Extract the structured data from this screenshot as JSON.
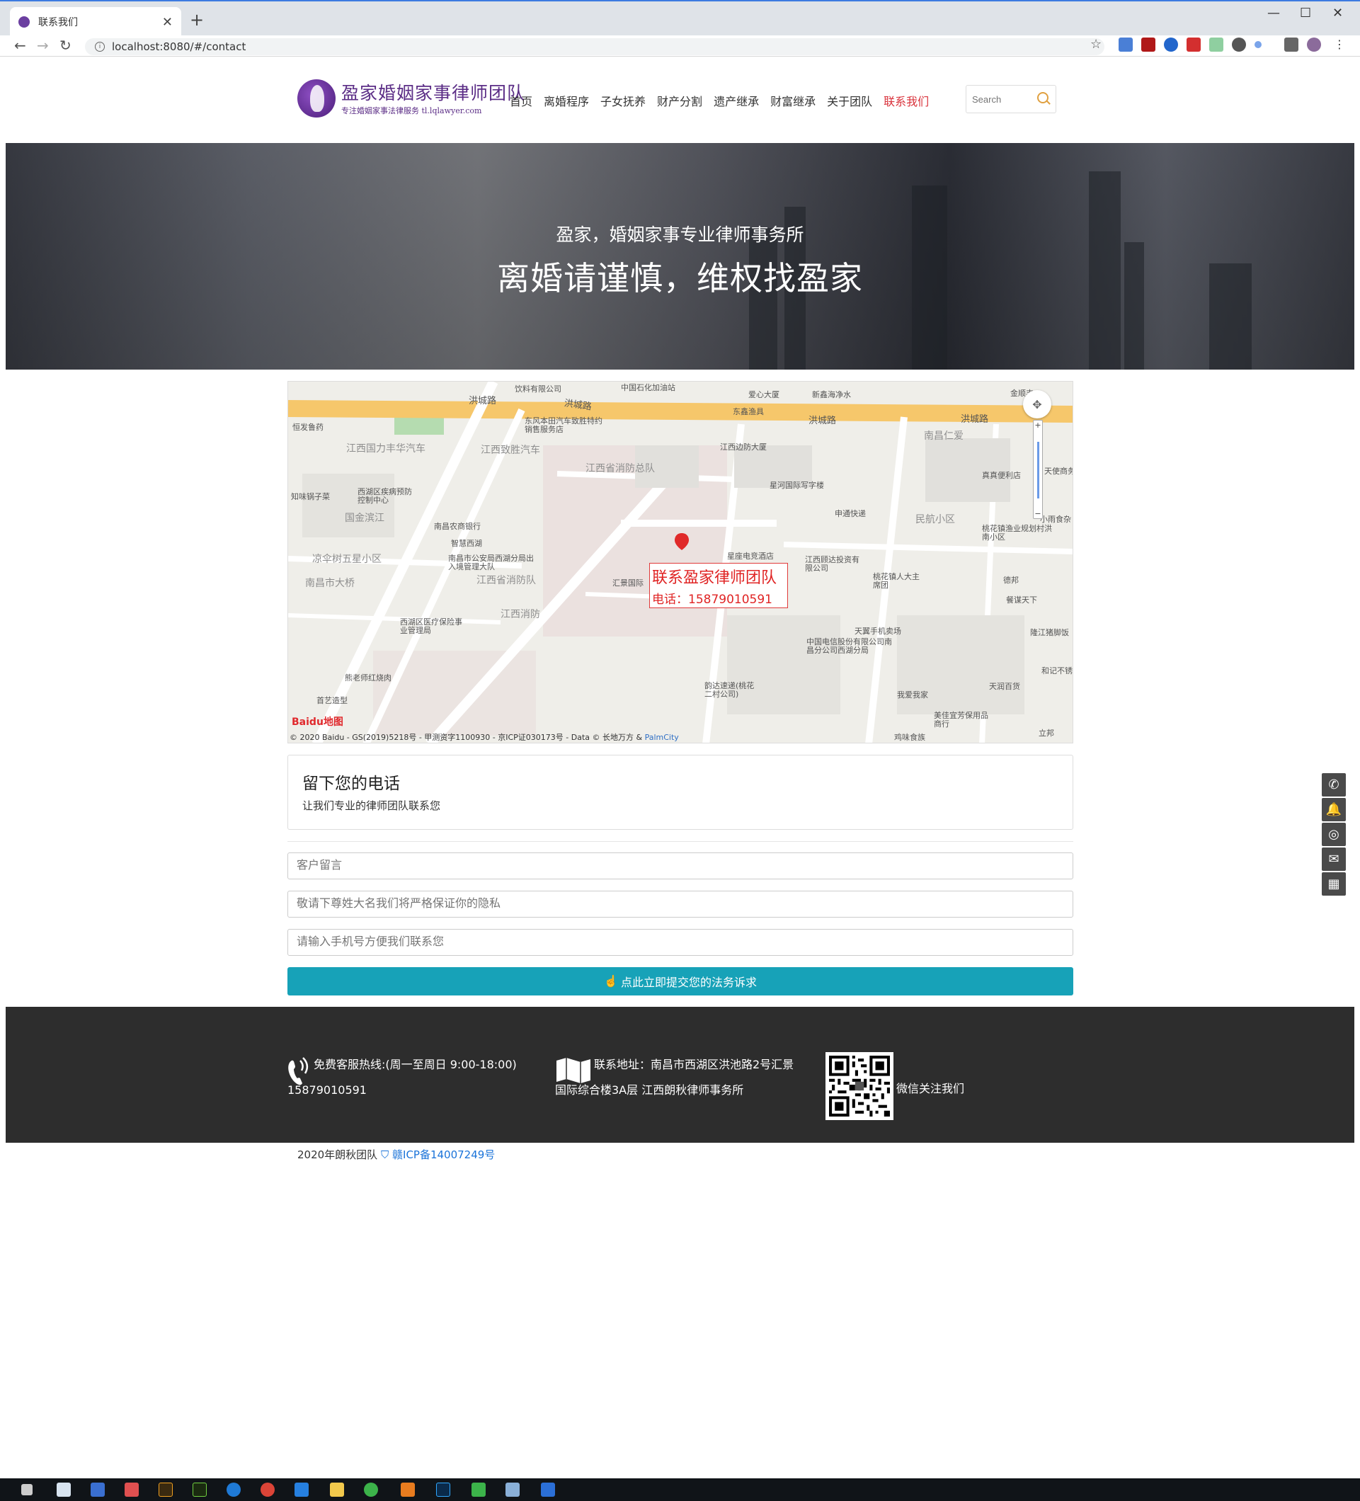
{
  "browser": {
    "tab_title": "联系我们",
    "tab_close": "✕",
    "new_tab": "+",
    "url": "localhost:8080/#/contact",
    "win_min": "—",
    "win_max": "☐",
    "win_close": "✕"
  },
  "header": {
    "logo_name": "盈家婚姻家事律师团队",
    "logo_sub": "专注婚姻家事法律服务 tl.lqlawyer.com",
    "nav": [
      "首页",
      "离婚程序",
      "子女抚养",
      "财产分割",
      "遗产继承",
      "财富继承",
      "关于团队",
      "联系我们"
    ],
    "active_nav": "联系我们",
    "search_placeholder": "Search"
  },
  "hero": {
    "subtitle": "盈家，婚姻家事专业律师事务所",
    "title": "离婚请谨慎，维权找盈家"
  },
  "map": {
    "label_title": "联系盈家律师团队",
    "label_phone": "电话：15879010591",
    "roads": [
      "洪城路",
      "洪城路",
      "洪城路",
      "洪城路"
    ],
    "pois_large": [
      "江西国力丰华汽车",
      "江西致胜汽车",
      "江西省消防总队",
      "国金滨江",
      "凉伞树五星小区",
      "南昌市大桥",
      "江西省消防队",
      "江西消防",
      "南昌仁爱",
      "民航小区"
    ],
    "pois": [
      "饮料有限公司",
      "中国石化加油站",
      "爱心大厦",
      "新鑫海净水",
      "金顺丰",
      "恒发鲁药",
      "东风本田汽车致胜特约销售服务店",
      "东鑫渔具",
      "江西边防大厦",
      "星河国际写字楼",
      "真真便利店",
      "天使商务",
      "知味锅子菜",
      "西湖区疾病预防控制中心",
      "南昌农商银行",
      "申通快递",
      "智慧西湖",
      "南昌市公安局西湖分局出入境管理大队",
      "星座电竞酒店",
      "江西顾达投资有限公司",
      "桃花镇渔业规划村洪南小区",
      "桃花镇人大主席团",
      "德邦",
      "餐谋天下",
      "西湖区医疗保险事业管理局",
      "天翼手机卖场",
      "中国电信股份有限公司南昌分公司西湖分局",
      "隆江猪脚饭",
      "熊老师红烧肉",
      "首艺造型",
      "韵达速递(桃花二村公司)",
      "我爱我家",
      "天润百货",
      "和记不锈",
      "美佳宜芳保用品商行",
      "立邦",
      "鸡味食族",
      "汇景国际",
      "小雨食杂"
    ],
    "copyright": "© 2020 Baidu - GS(2019)5218号 - 甲测资字1100930 - 京ICP证030173号 - Data © 长地万方 & ",
    "copyright_link": "PalmCity",
    "baidu_logo": "Baidu地图"
  },
  "leave": {
    "title": "留下您的电话",
    "desc": "让我们专业的律师团队联系您"
  },
  "form": {
    "message_placeholder": "客户留言",
    "name_placeholder": "敬请下尊姓大名我们将严格保证你的隐私",
    "phone_placeholder": "请输入手机号方便我们联系您",
    "submit_label": "点此立即提交您的法务诉求"
  },
  "footer": {
    "hotline": "免费客服热线:(周一至周日 9:00-18:00) 15879010591",
    "address": "联系地址：南昌市西湖区洪池路2号汇景国际综合楼3A层 江西朗秋律师事务所",
    "wechat": "微信关注我们"
  },
  "copyright": {
    "text": "2020年朗秋团队",
    "icp": "赣ICP备14007249号"
  },
  "sidebar": [
    "phone-icon",
    "bell-icon",
    "wechat-icon",
    "chat-icon",
    "qrcode-icon"
  ]
}
